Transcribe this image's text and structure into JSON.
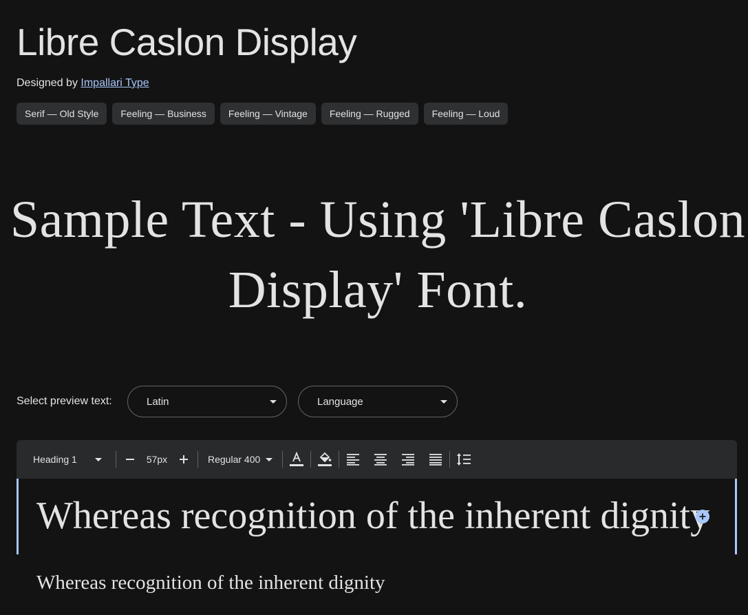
{
  "font": {
    "name": "Libre Caslon Display",
    "designed_by_prefix": "Designed by ",
    "designer": "Impallari Type"
  },
  "tags": [
    {
      "label": "Serif — Old Style"
    },
    {
      "label": "Feeling — Business"
    },
    {
      "label": "Feeling — Vintage"
    },
    {
      "label": "Feeling — Rugged"
    },
    {
      "label": "Feeling — Loud"
    }
  ],
  "sample_text": "Sample Text - Using 'Libre Caslon Display' Font.",
  "preview": {
    "label": "Select preview text:",
    "script_select": "Latin",
    "language_select": "Language"
  },
  "toolbar": {
    "style": "Heading 1",
    "size": "57px",
    "weight": "Regular 400",
    "icons": [
      "text-color-icon",
      "highlight-color-icon",
      "align-left-icon",
      "align-center-icon",
      "align-right-icon",
      "align-justify-icon",
      "line-height-icon"
    ]
  },
  "editor": {
    "row1_text": "Whereas recognition of the inherent dignity",
    "row2_text": "Whereas recognition of the inherent dignity"
  },
  "colors": {
    "background": "#131314",
    "accent": "#a8c7fa",
    "chip": "#2f3032",
    "toolbar": "#282a2c"
  }
}
